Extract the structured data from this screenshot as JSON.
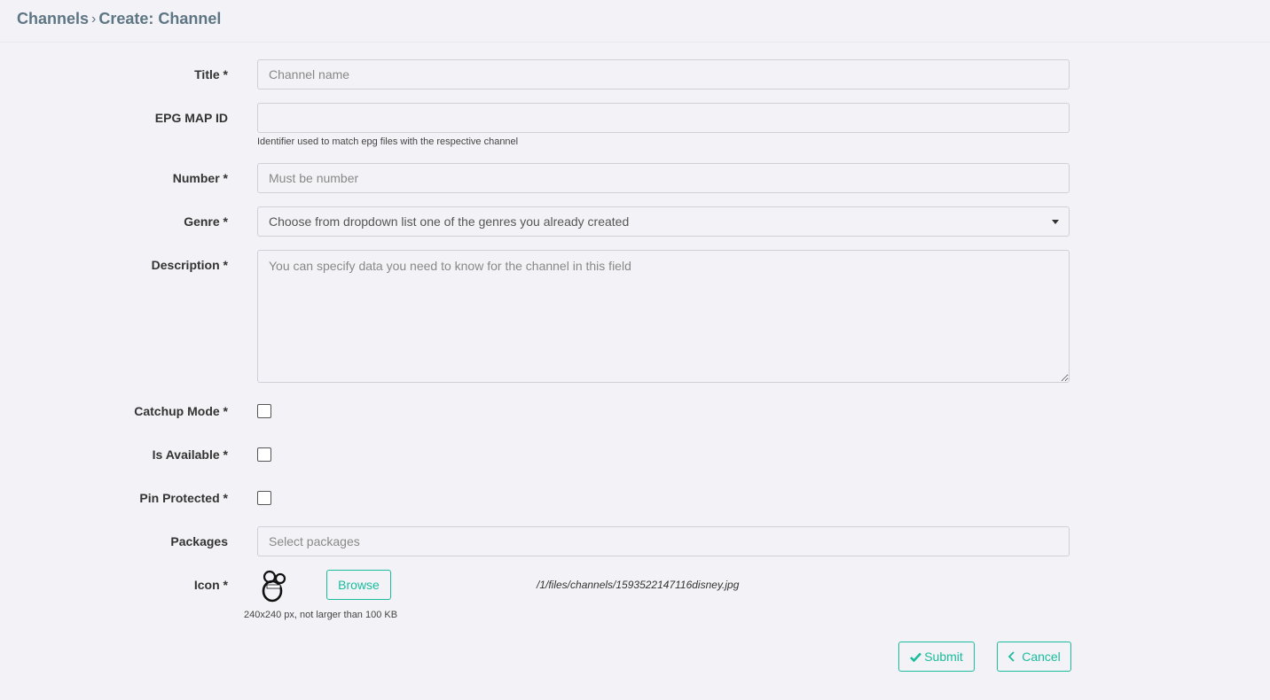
{
  "breadcrumb": {
    "parent": "Channels",
    "separator": "›",
    "current": "Create: Channel"
  },
  "form": {
    "title": {
      "label": "Title *",
      "placeholder": "Channel name",
      "value": ""
    },
    "epg": {
      "label": "EPG MAP ID",
      "value": "",
      "help": "Identifier used to match epg files with the respective channel"
    },
    "number": {
      "label": "Number *",
      "placeholder": "Must be number",
      "value": ""
    },
    "genre": {
      "label": "Genre *",
      "selected": "Choose from dropdown list one of the genres you already created"
    },
    "description": {
      "label": "Description *",
      "placeholder": "You can specify data you need to know for the channel in this field"
    },
    "catchup": {
      "label": "Catchup Mode *",
      "checked": false
    },
    "available": {
      "label": "Is Available *",
      "checked": false
    },
    "pin": {
      "label": "Pin Protected *",
      "checked": false
    },
    "packages": {
      "label": "Packages",
      "placeholder": "Select packages"
    },
    "icon": {
      "label": "Icon *",
      "browse_label": "Browse",
      "file_path": "/1/files/channels/1593522147116disney.jpg",
      "size_hint": "240x240 px, not larger than 100 KB",
      "thumb_icon": "disney-logo-icon"
    }
  },
  "actions": {
    "submit_label": "Submit",
    "cancel_label": "Cancel"
  },
  "colors": {
    "accent": "#1abc9c",
    "breadcrumb": "#5e7684",
    "background": "#f3f3f7"
  }
}
